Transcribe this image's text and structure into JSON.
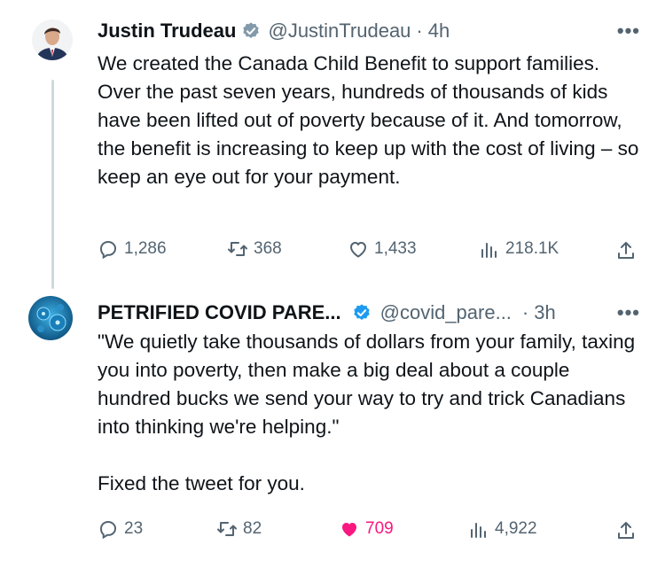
{
  "tweets": [
    {
      "author_name": "Justin Trudeau",
      "handle": "@JustinTrudeau",
      "separator": "·",
      "time": "4h",
      "more_label": "•••",
      "text": "We created the Canada Child Benefit to support families. Over the past seven years, hundreds of thousands of kids have been lifted out of poverty because of it. And tomorrow, the benefit is increasing to keep up with the cost of living – so keep an eye out for your payment.",
      "replies": "1,286",
      "retweets": "368",
      "likes": "1,433",
      "views": "218.1K",
      "verified_color": "#829aab",
      "liked": false
    },
    {
      "author_name": "PETRIFIED COVID PARE...",
      "handle": "@covid_pare...",
      "separator": "·",
      "time": "3h",
      "more_label": "•••",
      "text": "\"We quietly take thousands of dollars from your family, taxing you into poverty, then make a big deal about a couple hundred bucks we send your way to try and trick Canadians into thinking we're helping.\"\n\nFixed the tweet for you.",
      "replies": "23",
      "retweets": "82",
      "likes": "709",
      "views": "4,922",
      "verified_color": "#1d9bf0",
      "liked": true,
      "like_color": "#f91880"
    }
  ],
  "icons": {
    "reply": "reply-icon",
    "retweet": "retweet-icon",
    "like": "heart-icon",
    "views": "views-icon",
    "share": "share-icon",
    "verified": "verified-badge-icon",
    "more": "more-icon"
  }
}
